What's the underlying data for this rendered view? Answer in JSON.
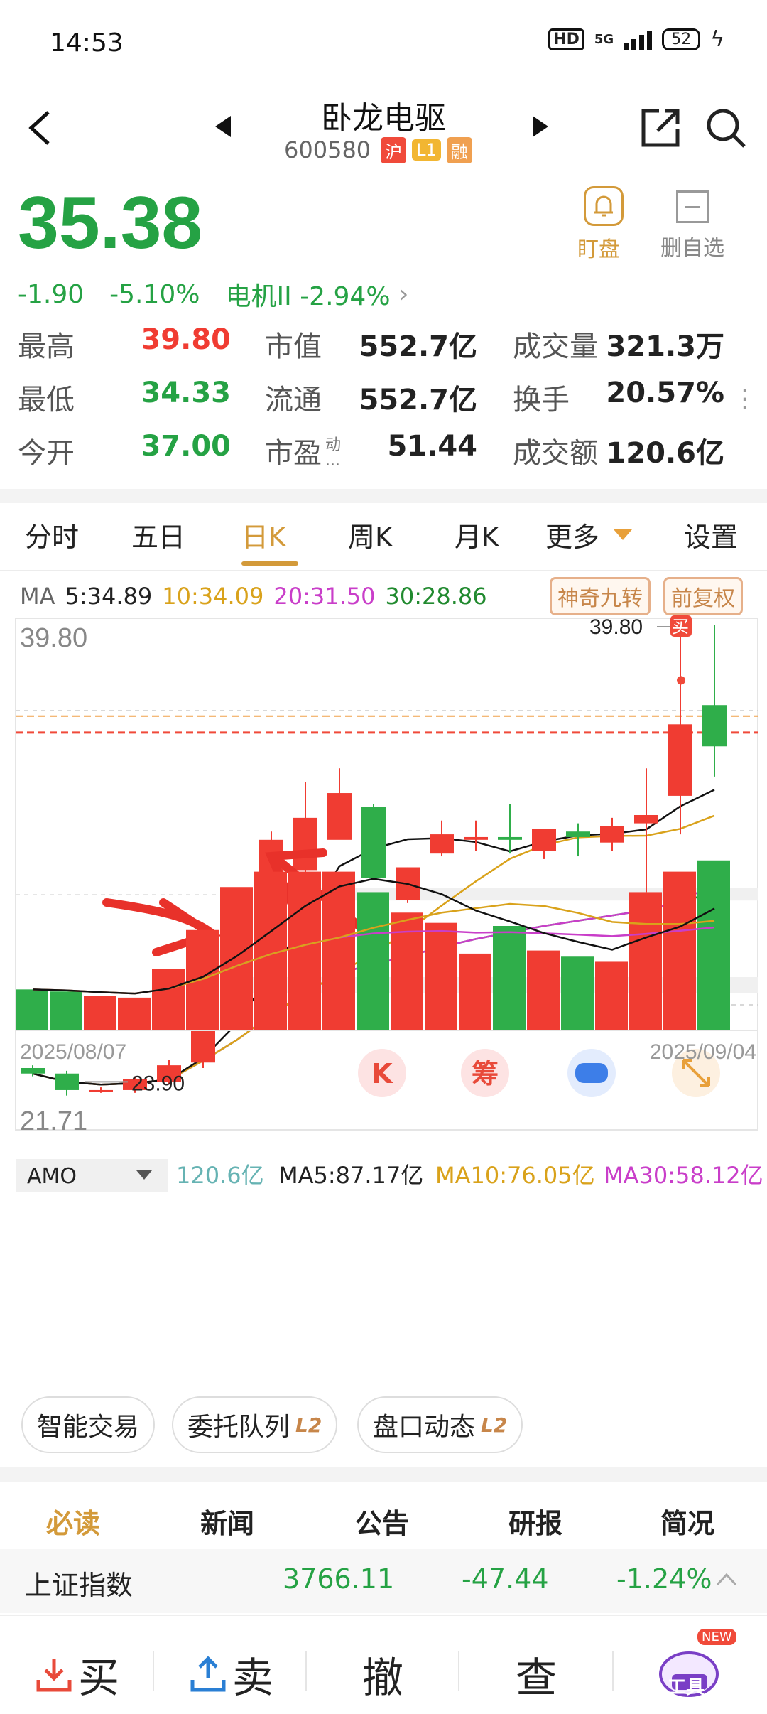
{
  "status": {
    "time": "14:53",
    "hd": "HD",
    "network": "5G",
    "battery": "52"
  },
  "header": {
    "name": "卧龙电驱",
    "code": "600580",
    "tags": [
      {
        "text": "沪",
        "color": "#f04a3a"
      },
      {
        "text": "L1",
        "color": "#f2b632"
      },
      {
        "text": "融",
        "color": "#f0a050"
      }
    ]
  },
  "quote": {
    "price": "35.38",
    "change": "-1.90",
    "pct": "-5.10%",
    "sector": "电机II -2.94%",
    "arrow": "›"
  },
  "actions": {
    "watch": "盯盘",
    "delete_fav": "删自选"
  },
  "stats": [
    {
      "label": "最高",
      "value": "39.80",
      "color": "red"
    },
    {
      "label": "市值",
      "value": "552.7亿",
      "color": ""
    },
    {
      "label": "成交量",
      "value": "321.3万",
      "color": ""
    },
    {
      "label": "最低",
      "value": "34.33",
      "color": "green"
    },
    {
      "label": "流通",
      "value": "552.7亿",
      "color": ""
    },
    {
      "label": "换手",
      "value": "20.57%",
      "color": ""
    },
    {
      "label": "今开",
      "value": "37.00",
      "color": "green"
    },
    {
      "label": "市盈",
      "value": "51.44",
      "color": ""
    },
    {
      "label": "成交额",
      "value": "120.6亿",
      "color": ""
    }
  ],
  "pe_sup": "动",
  "pe_sub": "...",
  "tabs": [
    "分时",
    "五日",
    "日K",
    "周K",
    "月K",
    "更多",
    "设置"
  ],
  "ma": {
    "label": "MA",
    "ma5": "5:34.89",
    "ma10": "10:34.09",
    "ma20": "20:31.50",
    "ma30": "30:28.86"
  },
  "chart_buttons": {
    "jiuzhuan": "神奇九转",
    "fuquan": "前复权"
  },
  "chart_labels": {
    "high": "39.80",
    "low": "21.71",
    "high_marker": "39.80",
    "low_marker": "23.90",
    "buy_mark": "买"
  },
  "float_icons": [
    "K",
    "筹"
  ],
  "volume": {
    "selector": "AMO",
    "current": "120.6亿",
    "ma5": "MA5:87.17亿",
    "ma10": "MA10:76.05亿",
    "ma30": "MA30:58.12亿"
  },
  "dates": {
    "start": "2025/08/07",
    "end": "2025/09/04"
  },
  "chart_data": {
    "type": "candlestick",
    "ylim": [
      21.71,
      39.8
    ],
    "candles": [
      {
        "o": 23.7,
        "h": 23.8,
        "l": 23.4,
        "c": 23.5
      },
      {
        "o": 23.5,
        "h": 23.6,
        "l": 22.7,
        "c": 22.9
      },
      {
        "o": 22.9,
        "h": 23.0,
        "l": 22.8,
        "c": 22.9
      },
      {
        "o": 22.9,
        "h": 23.4,
        "l": 22.8,
        "c": 23.3
      },
      {
        "o": 23.2,
        "h": 24.0,
        "l": 23.1,
        "c": 23.8
      },
      {
        "o": 23.9,
        "h": 27.6,
        "l": 23.7,
        "c": 27.4
      },
      {
        "o": 27.6,
        "h": 29.4,
        "l": 27.5,
        "c": 29.3
      },
      {
        "o": 30.8,
        "h": 32.3,
        "l": 30.0,
        "c": 32.0
      },
      {
        "o": 30.9,
        "h": 34.1,
        "l": 29.8,
        "c": 32.8
      },
      {
        "o": 32.0,
        "h": 34.6,
        "l": 32.2,
        "c": 33.7
      },
      {
        "o": 33.2,
        "h": 33.3,
        "l": 30.6,
        "c": 30.6
      },
      {
        "o": 29.8,
        "h": 31.0,
        "l": 29.7,
        "c": 31.0
      },
      {
        "o": 31.5,
        "h": 32.7,
        "l": 31.4,
        "c": 32.2
      },
      {
        "o": 32.0,
        "h": 32.7,
        "l": 31.6,
        "c": 32.1
      },
      {
        "o": 32.1,
        "h": 33.3,
        "l": 31.5,
        "c": 32.0
      },
      {
        "o": 31.6,
        "h": 32.3,
        "l": 31.3,
        "c": 32.4
      },
      {
        "o": 32.3,
        "h": 32.6,
        "l": 31.4,
        "c": 32.1
      },
      {
        "o": 31.9,
        "h": 32.8,
        "l": 31.6,
        "c": 32.5
      },
      {
        "o": 32.6,
        "h": 34.6,
        "l": 30.1,
        "c": 32.9
      },
      {
        "o": 33.6,
        "h": 39.8,
        "l": 32.2,
        "c": 36.2
      },
      {
        "o": 36.9,
        "h": 39.8,
        "l": 34.3,
        "c": 35.4
      }
    ],
    "volume": [
      40,
      38,
      34,
      32,
      60,
      98,
      140,
      155,
      155,
      155,
      135,
      115,
      105,
      75,
      102,
      78,
      72,
      67,
      135,
      155,
      166
    ]
  },
  "pills": [
    {
      "text": "智能交易",
      "badge": ""
    },
    {
      "text": "委托队列",
      "badge": "L2"
    },
    {
      "text": "盘口动态",
      "badge": "L2"
    }
  ],
  "news_tabs": [
    "必读",
    "新闻",
    "公告",
    "研报",
    "简况"
  ],
  "index": {
    "name": "上证指数",
    "value": "3766.11",
    "change": "-47.44",
    "pct": "-1.24%"
  },
  "bottom": {
    "buy": "买",
    "sell": "卖",
    "cancel": "撤",
    "query": "查",
    "tools": "工具",
    "new_badge": "NEW"
  }
}
